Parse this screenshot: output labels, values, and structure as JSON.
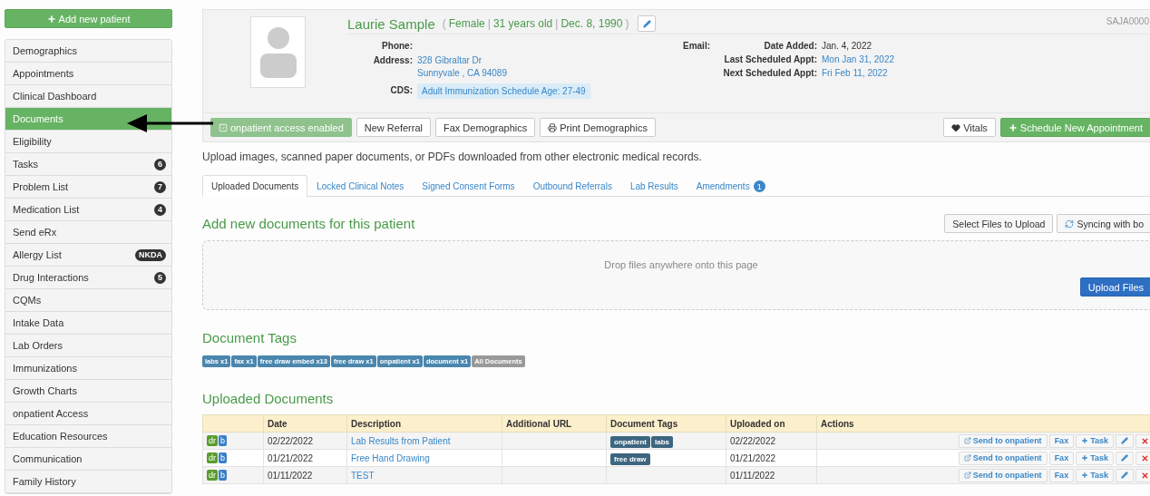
{
  "sidebar": {
    "add_button": "Add new patient",
    "items": [
      {
        "label": "Demographics",
        "selected": false
      },
      {
        "label": "Appointments",
        "selected": false
      },
      {
        "label": "Clinical Dashboard",
        "selected": false
      },
      {
        "label": "Documents",
        "selected": true
      },
      {
        "label": "Eligibility",
        "selected": false
      },
      {
        "label": "Tasks",
        "badge": "6",
        "selected": false
      },
      {
        "label": "Problem List",
        "badge": "7",
        "selected": false
      },
      {
        "label": "Medication List",
        "badge": "4",
        "selected": false
      },
      {
        "label": "Send eRx",
        "selected": false
      },
      {
        "label": "Allergy List",
        "badge": "NKDA",
        "selected": false
      },
      {
        "label": "Drug Interactions",
        "badge": "5",
        "selected": false
      },
      {
        "label": "CQMs",
        "selected": false
      },
      {
        "label": "Intake Data",
        "selected": false
      },
      {
        "label": "Lab Orders",
        "selected": false
      },
      {
        "label": "Immunizations",
        "selected": false
      },
      {
        "label": "Growth Charts",
        "selected": false
      },
      {
        "label": "onpatient Access",
        "selected": false
      },
      {
        "label": "Education Resources",
        "selected": false
      },
      {
        "label": "Communication",
        "selected": false
      },
      {
        "label": "Family History",
        "selected": false
      }
    ]
  },
  "patient": {
    "name": "Laurie Sample",
    "details": [
      "Female",
      "31 years old",
      "Dec. 8, 1990"
    ],
    "details_open": "(",
    "details_separator": "|",
    "details_close": ")",
    "id": "SAJA0000",
    "phone_label": "Phone:",
    "email_label": "Email:",
    "address_label": "Address:",
    "address": [
      "328 Gibraltar Dr",
      "Sunnyvale , CA 94089"
    ],
    "cds_label": "CDS:",
    "cds": "Adult Immunization Schedule Age: 27-49",
    "right_fields": [
      {
        "label": "Date Added:",
        "value": "Jan. 4, 2022",
        "kind": "text"
      },
      {
        "label": "Last Scheduled Appt:",
        "value": "Mon Jan 31, 2022",
        "kind": "link"
      },
      {
        "label": "Next Scheduled Appt:",
        "value": "Fri Feb 11, 2022",
        "kind": "link"
      }
    ],
    "buttons": [
      {
        "label": "onpatient access enabled",
        "kind": "access"
      },
      {
        "label": "New Referral",
        "kind": "plain"
      },
      {
        "label": "Fax Demographics",
        "kind": "plain"
      },
      {
        "label": "Print Demographics",
        "kind": "print"
      }
    ],
    "right_buttons": [
      {
        "label": "Vitals",
        "kind": "vitals"
      },
      {
        "label": "Schedule New Appointment",
        "kind": "schedule"
      }
    ]
  },
  "intro": "Upload images, scanned paper documents, or PDFs downloaded from other electronic medical records.",
  "tabs": [
    {
      "label": "Uploaded Documents",
      "selected": true
    },
    {
      "label": "Locked Clinical Notes",
      "selected": false
    },
    {
      "label": "Signed Consent Forms",
      "selected": false
    },
    {
      "label": "Outbound Referrals",
      "selected": false
    },
    {
      "label": "Lab Results",
      "selected": false
    },
    {
      "label": "Amendments",
      "badge": "1",
      "selected": false
    }
  ],
  "upload": {
    "title": "Add new documents for this patient",
    "select_button": "Select Files to Upload",
    "sync_button": "Syncing with bo",
    "drop_text": "Drop files anywhere onto this page",
    "upload_button": "Upload Files"
  },
  "tags_section": {
    "title": "Document Tags",
    "tags": [
      {
        "label": "labs x1",
        "kind": "tag"
      },
      {
        "label": "fax x1",
        "kind": "tag"
      },
      {
        "label": "free draw embed x13",
        "kind": "tag"
      },
      {
        "label": "free draw x1",
        "kind": "tag"
      },
      {
        "label": "onpatient x1",
        "kind": "tag"
      },
      {
        "label": "document x1",
        "kind": "tag"
      },
      {
        "label": "All Documents",
        "kind": "all"
      }
    ]
  },
  "documents": {
    "title": "Uploaded Documents",
    "columns": [
      "Date",
      "Description",
      "Additional URL",
      "Document Tags",
      "Uploaded on",
      "Actions"
    ],
    "rows": [
      {
        "icons": [
          "dr",
          "b"
        ],
        "date": "02/22/2022",
        "description": "Lab Results from Patient",
        "tags": [
          "onpatient",
          "labs"
        ],
        "uploaded_on": "02/22/2022",
        "actions": [
          "Send to onpatient",
          "Fax",
          "Task"
        ]
      },
      {
        "icons": [
          "dr",
          "b"
        ],
        "date": "01/21/2022",
        "description": "Free Hand Drawing",
        "tags": [
          "free draw"
        ],
        "uploaded_on": "01/21/2022",
        "actions": [
          "Send to onpatient",
          "Fax",
          "Task"
        ]
      },
      {
        "icons": [
          "dr",
          "b"
        ],
        "date": "01/11/2022",
        "description": "TEST",
        "uploaded_on": "01/11/2022",
        "actions": [
          "Send to onpatient",
          "Fax",
          "Task"
        ]
      }
    ]
  }
}
